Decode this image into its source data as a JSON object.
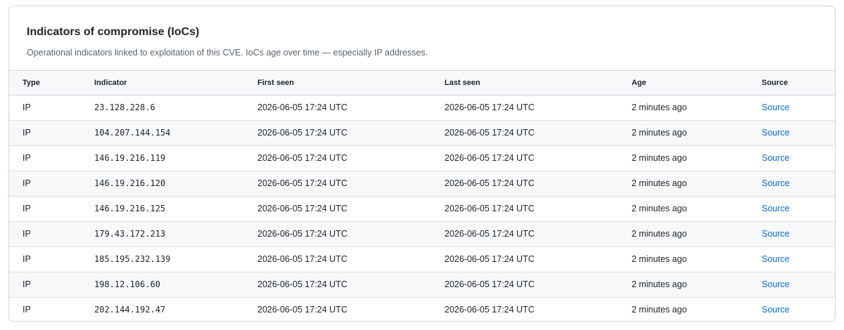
{
  "header": {
    "title": "Indicators of compromise (IoCs)",
    "subtitle": "Operational indicators linked to exploitation of this CVE. IoCs age over time — especially IP addresses."
  },
  "table": {
    "columns": [
      "Type",
      "Indicator",
      "First seen",
      "Last seen",
      "Age",
      "Source"
    ],
    "rows": [
      {
        "type": "IP",
        "indicator": "23.128.228.6",
        "first_seen": "2026-06-05 17:24 UTC",
        "last_seen": "2026-06-05 17:24 UTC",
        "age": "2 minutes ago",
        "source": "Source"
      },
      {
        "type": "IP",
        "indicator": "104.207.144.154",
        "first_seen": "2026-06-05 17:24 UTC",
        "last_seen": "2026-06-05 17:24 UTC",
        "age": "2 minutes ago",
        "source": "Source"
      },
      {
        "type": "IP",
        "indicator": "146.19.216.119",
        "first_seen": "2026-06-05 17:24 UTC",
        "last_seen": "2026-06-05 17:24 UTC",
        "age": "2 minutes ago",
        "source": "Source"
      },
      {
        "type": "IP",
        "indicator": "146.19.216.120",
        "first_seen": "2026-06-05 17:24 UTC",
        "last_seen": "2026-06-05 17:24 UTC",
        "age": "2 minutes ago",
        "source": "Source"
      },
      {
        "type": "IP",
        "indicator": "146.19.216.125",
        "first_seen": "2026-06-05 17:24 UTC",
        "last_seen": "2026-06-05 17:24 UTC",
        "age": "2 minutes ago",
        "source": "Source"
      },
      {
        "type": "IP",
        "indicator": "179.43.172.213",
        "first_seen": "2026-06-05 17:24 UTC",
        "last_seen": "2026-06-05 17:24 UTC",
        "age": "2 minutes ago",
        "source": "Source"
      },
      {
        "type": "IP",
        "indicator": "185.195.232.139",
        "first_seen": "2026-06-05 17:24 UTC",
        "last_seen": "2026-06-05 17:24 UTC",
        "age": "2 minutes ago",
        "source": "Source"
      },
      {
        "type": "IP",
        "indicator": "198.12.106.60",
        "first_seen": "2026-06-05 17:24 UTC",
        "last_seen": "2026-06-05 17:24 UTC",
        "age": "2 minutes ago",
        "source": "Source"
      },
      {
        "type": "IP",
        "indicator": "202.144.192.47",
        "first_seen": "2026-06-05 17:24 UTC",
        "last_seen": "2026-06-05 17:24 UTC",
        "age": "2 minutes ago",
        "source": "Source"
      }
    ]
  },
  "colors": {
    "link": "#0969da",
    "border": "#d0d7de",
    "stripe": "#f6f8fa",
    "subtitle": "#59636e"
  }
}
